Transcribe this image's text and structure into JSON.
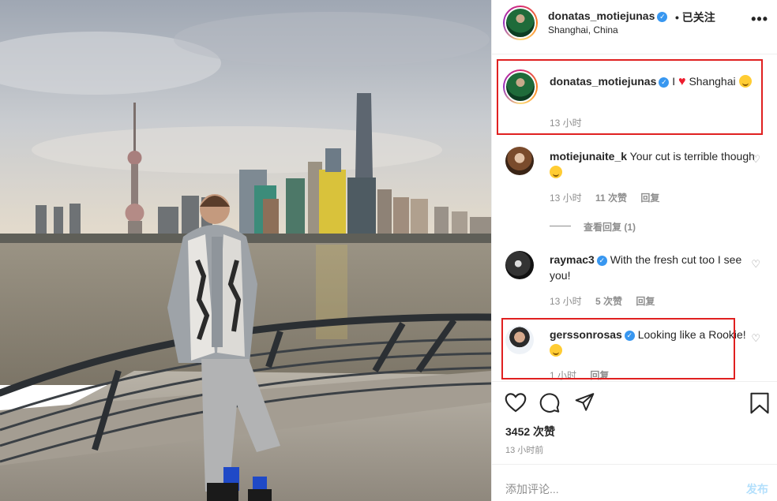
{
  "header": {
    "username": "donatas_motiejunas",
    "follow_state": "• 已关注",
    "location": "Shanghai, China",
    "more_icon": "more-horizontal-icon"
  },
  "caption": {
    "username": "donatas_motiejunas",
    "text_before": "I",
    "text_after": "Shanghai",
    "time": "13 小时"
  },
  "comments": [
    {
      "username": "motiejunaite_k",
      "text": "Your cut is terrible though",
      "time": "13 小时",
      "likes": "11 次赞",
      "reply": "回复",
      "view_replies": "查看回复 (1)"
    },
    {
      "username": "raymac3",
      "text": "With the fresh cut too I see you!",
      "time": "13 小时",
      "likes": "5 次赞",
      "reply": "回复"
    },
    {
      "username": "gerssonrosas",
      "text": "Looking like a Rookie!",
      "time": "1 小时",
      "reply": "回复"
    }
  ],
  "actions": {
    "like_icon": "heart-outline-icon",
    "comment_icon": "comment-bubble-icon",
    "share_icon": "paper-plane-icon",
    "save_icon": "bookmark-icon",
    "likes_count": "3452 次赞",
    "posted_ago": "13 小时前"
  },
  "add_comment": {
    "placeholder": "添加评论...",
    "post_label": "发布"
  },
  "colors": {
    "highlight_border": "#e02020",
    "verified_badge": "#3897f0",
    "secondary_text": "#8e8e8e",
    "post_button_disabled": "#b2dffc"
  }
}
